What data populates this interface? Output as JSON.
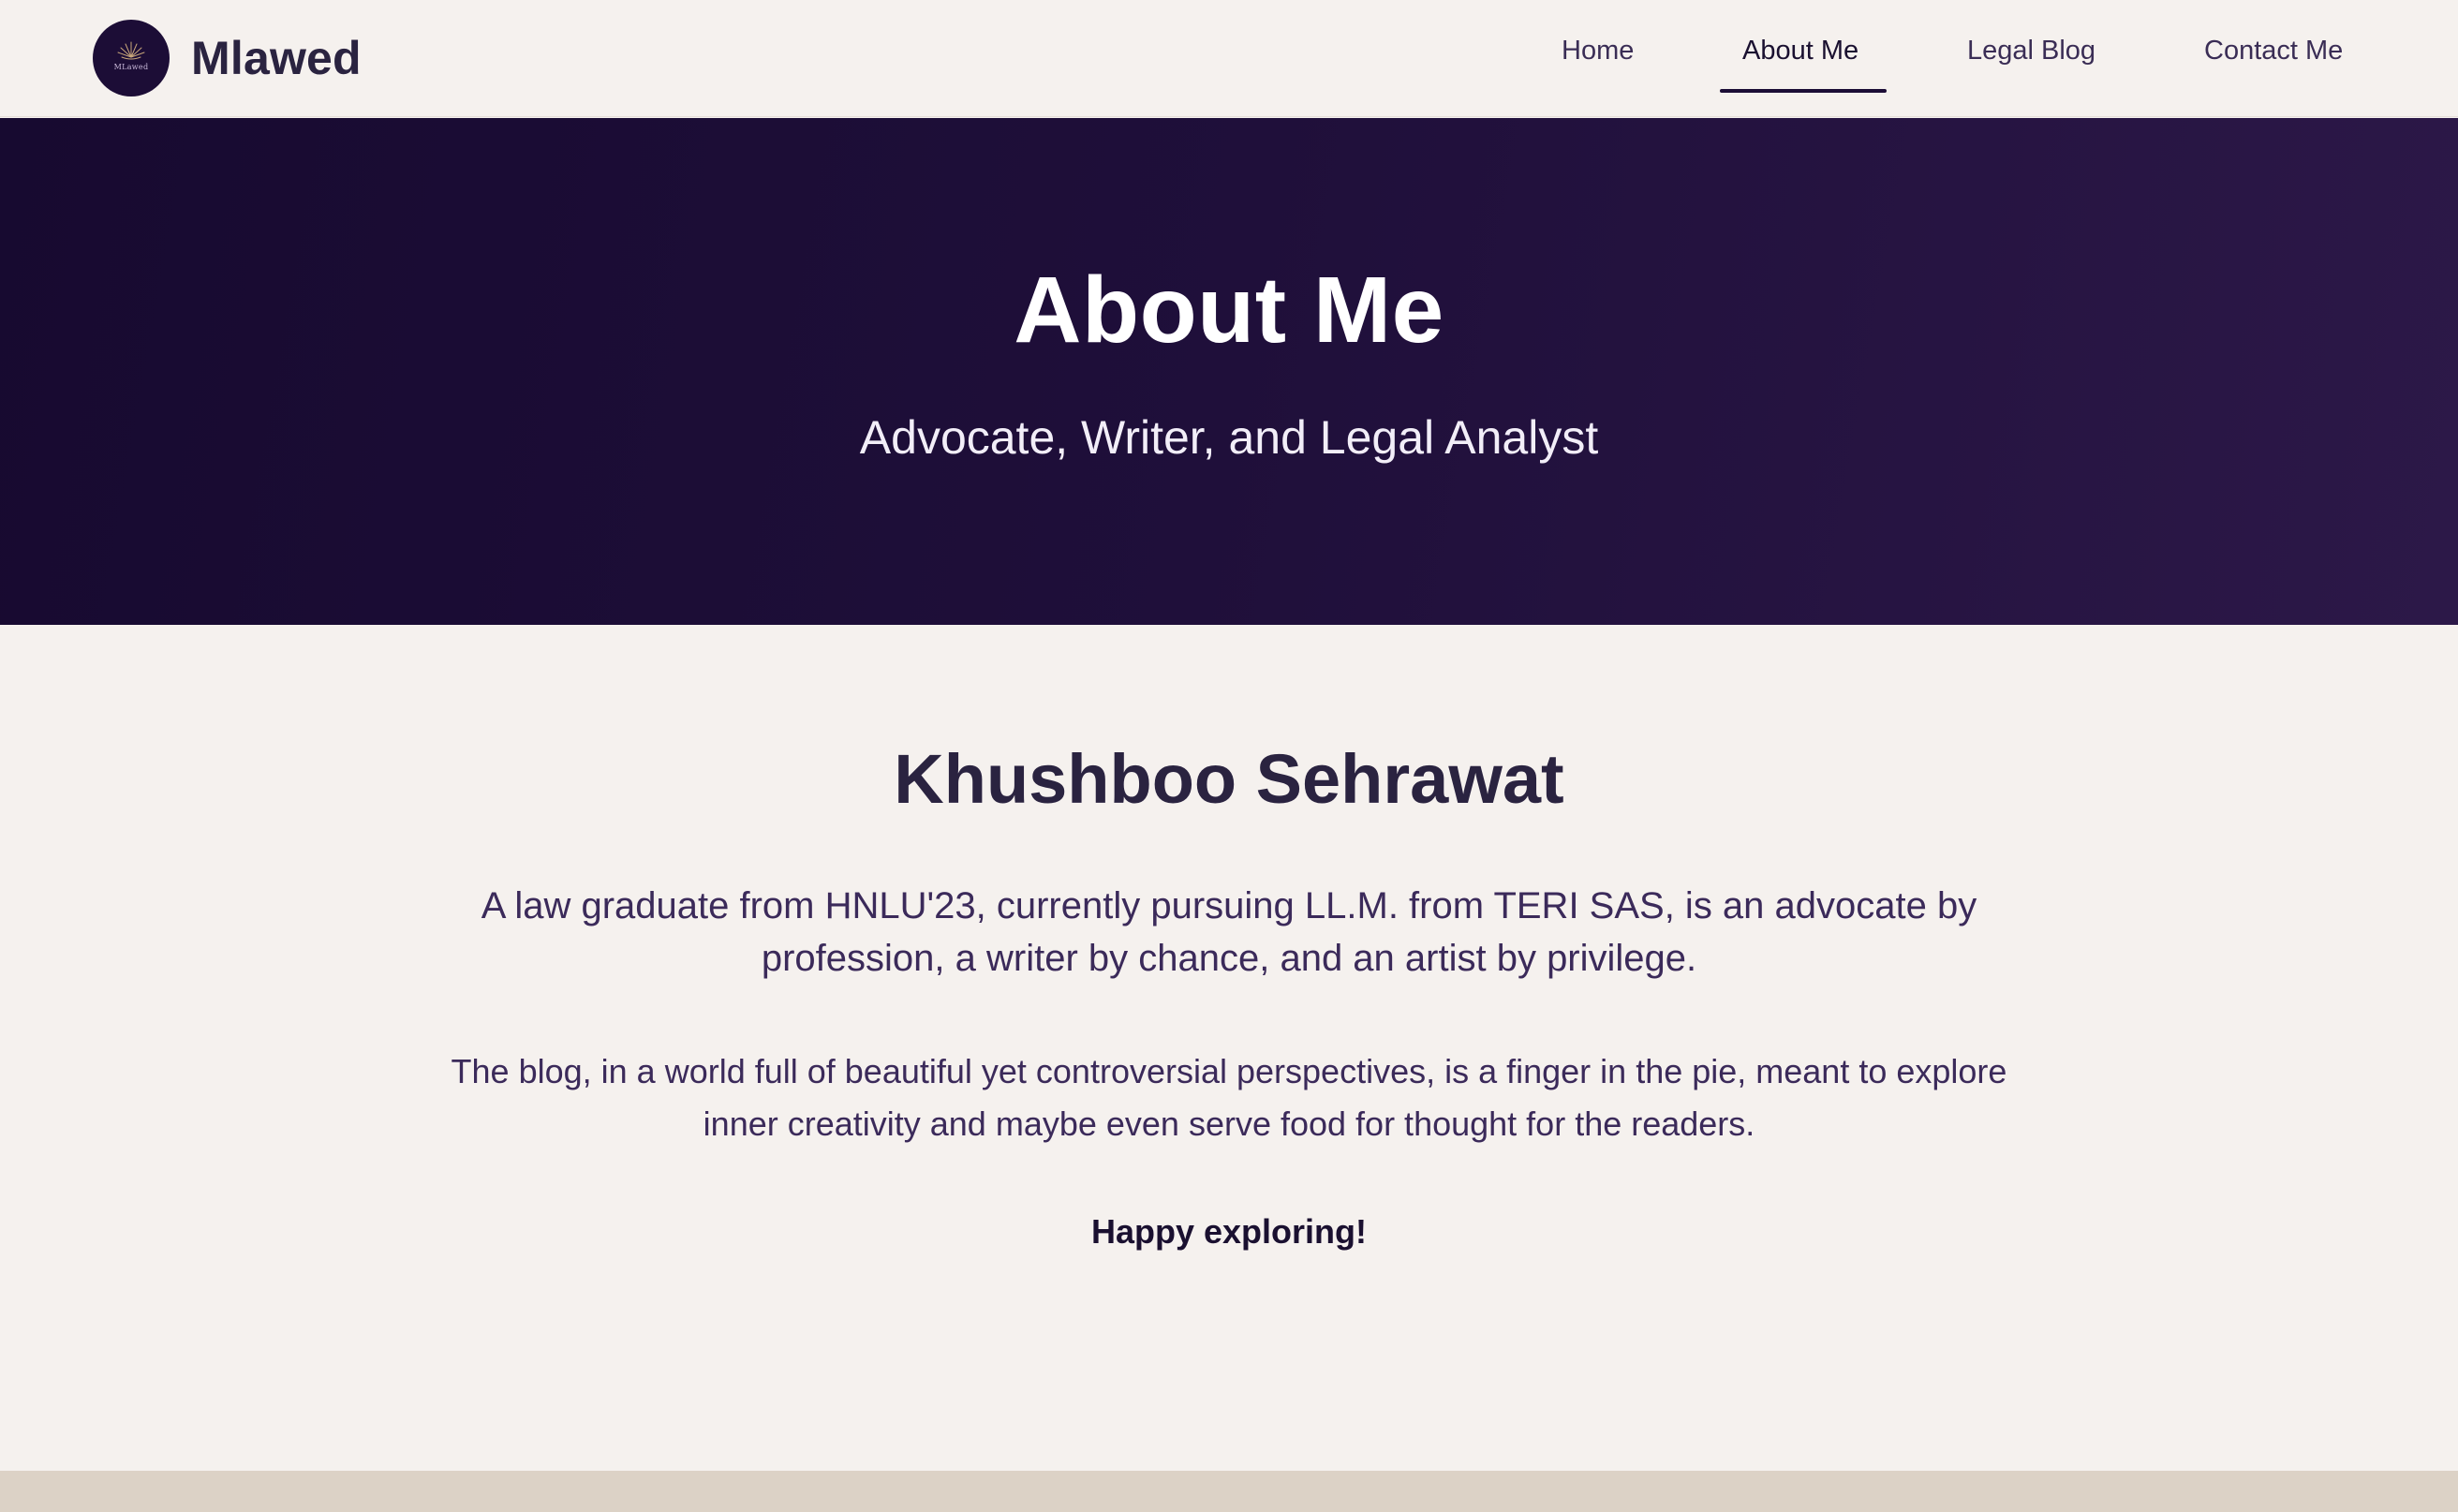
{
  "brand": {
    "name": "Mlawed",
    "logo_text": "MLawed"
  },
  "nav": {
    "items": [
      {
        "label": "Home",
        "active": false
      },
      {
        "label": "About Me",
        "active": true
      },
      {
        "label": "Legal Blog",
        "active": false
      },
      {
        "label": "Contact Me",
        "active": false
      }
    ]
  },
  "hero": {
    "title": "About Me",
    "subtitle": "Advocate, Writer, and Legal Analyst"
  },
  "about": {
    "name": "Khushboo Sehrawat",
    "paragraph_1": "A law graduate from HNLU'23, currently pursuing LL.M. from TERI SAS, is an advocate by profession, a writer by chance, and an artist by privilege.",
    "paragraph_2": "The blog, in a world full of beautiful yet controversial perspectives, is a finger in the pie, meant to explore inner creativity and maybe even serve food for thought for the readers.",
    "closing": "Happy exploring!"
  },
  "colors": {
    "hero_dark": "#170a30",
    "hero_light": "#2c1848",
    "page_bg": "#f5f1ee",
    "footer_bg": "#dcd2c6",
    "heading": "#2a2340",
    "body_text": "#3b2a5a"
  },
  "icons": {
    "logo": "lotus-logo-icon"
  }
}
